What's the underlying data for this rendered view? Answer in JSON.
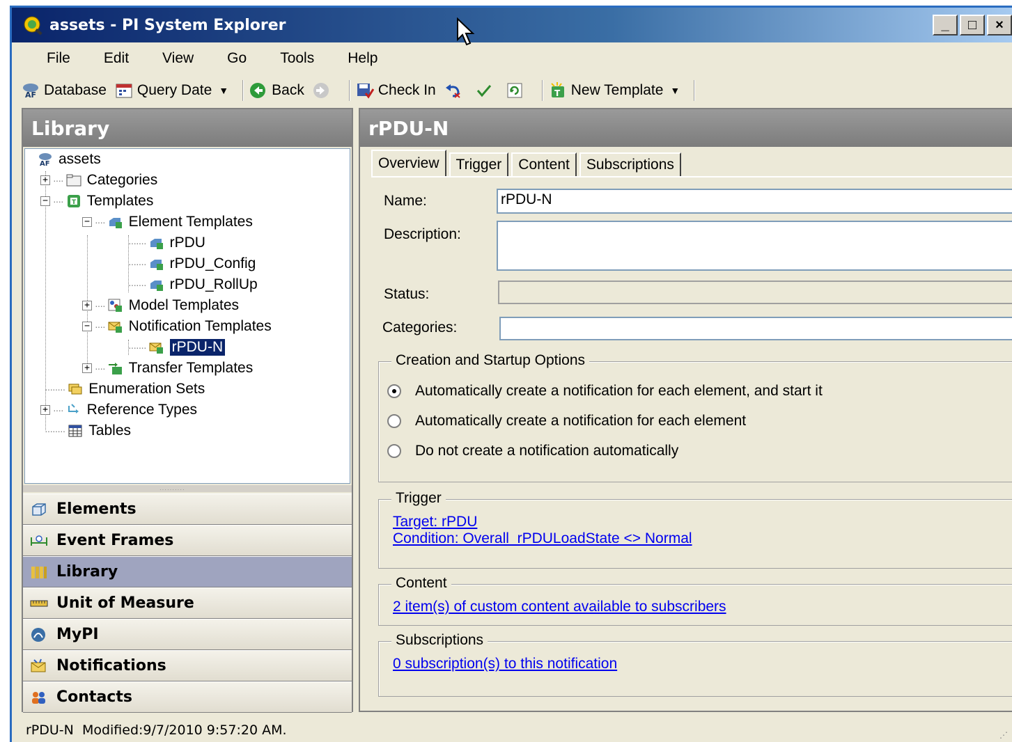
{
  "window": {
    "title": "assets - PI System Explorer",
    "controls": [
      "_",
      "□",
      "×"
    ]
  },
  "menu": [
    "File",
    "Edit",
    "View",
    "Go",
    "Tools",
    "Help"
  ],
  "toolbar": {
    "database": "Database",
    "query_date": "Query Date",
    "back": "Back",
    "check_in": "Check In",
    "new_template": "New Template"
  },
  "library": {
    "header": "Library",
    "tree": {
      "root": "assets",
      "categories": "Categories",
      "templates": "Templates",
      "element_templates": "Element Templates",
      "et_items": [
        "rPDU",
        "rPDU_Config",
        "rPDU_RollUp"
      ],
      "model_templates": "Model Templates",
      "notification_templates": "Notification Templates",
      "nt_items": [
        "rPDU-N"
      ],
      "transfer_templates": "Transfer Templates",
      "enumeration_sets": "Enumeration Sets",
      "reference_types": "Reference Types",
      "tables": "Tables"
    }
  },
  "nav": [
    "Elements",
    "Event Frames",
    "Library",
    "Unit of Measure",
    "MyPI",
    "Notifications",
    "Contacts"
  ],
  "nav_active": "Library",
  "detail": {
    "header": "rPDU-N",
    "tabs": [
      "Overview",
      "Trigger",
      "Content",
      "Subscriptions"
    ],
    "active_tab": "Overview",
    "name_label": "Name:",
    "name_value": "rPDU-N",
    "description_label": "Description:",
    "description_value": "",
    "status_label": "Status:",
    "status_value": "",
    "categories_label": "Categories:",
    "categories_value": "",
    "creation_group": "Creation and Startup Options",
    "options": [
      "Automatically create a notification for each element, and start it",
      "Automatically create a notification for each element",
      "Do not create a notification automatically"
    ],
    "selected_option": 0,
    "trigger_group": "Trigger",
    "trigger_target": "Target: rPDU",
    "trigger_condition": "Condition: Overall_rPDULoadState <> Normal",
    "content_group": "Content",
    "content_link": "2 item(s) of custom content available to subscribers",
    "subscriptions_group": "Subscriptions",
    "subscriptions_link": "0 subscription(s) to this notification"
  },
  "status_bar": "rPDU-N  Modified:9/7/2010 9:57:20 AM."
}
